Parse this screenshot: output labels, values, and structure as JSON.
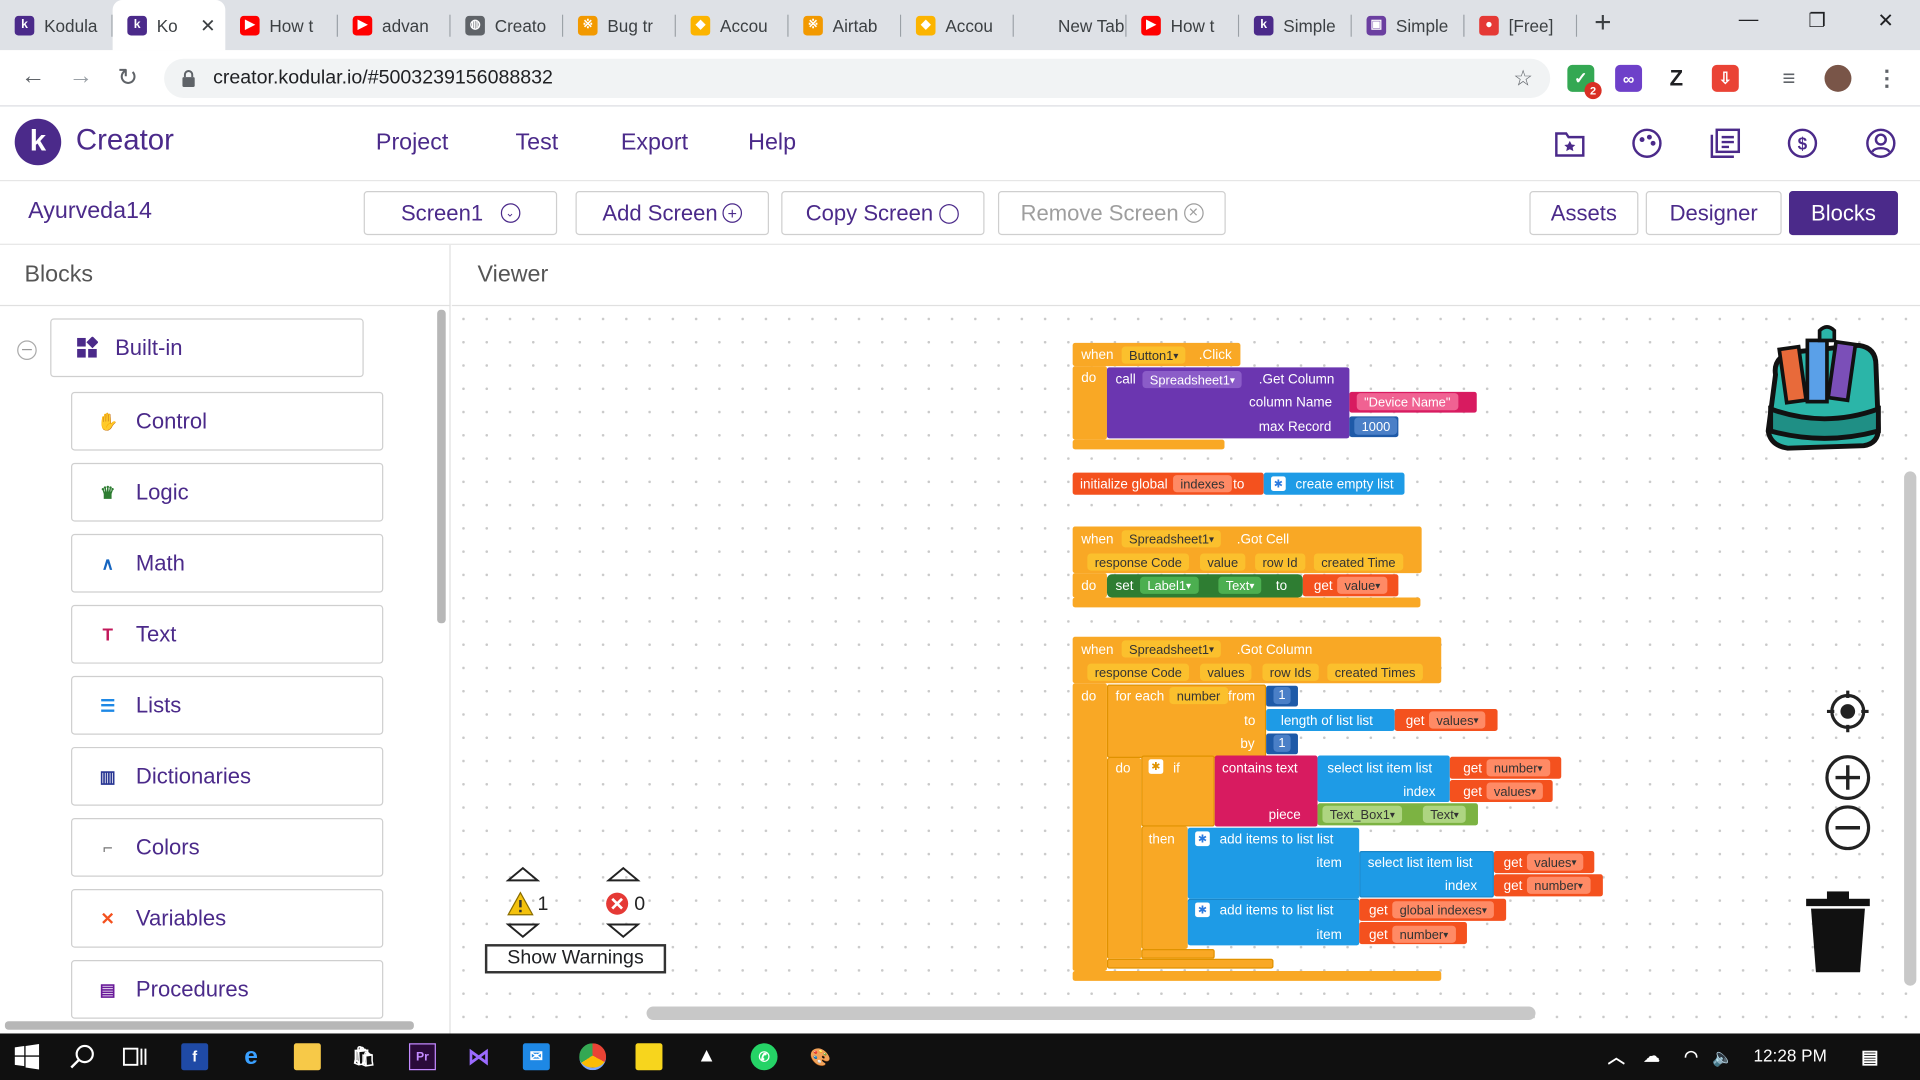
{
  "browser": {
    "tabs": [
      {
        "title": "Kodula",
        "fav": "k",
        "color": "#4b2a8a"
      },
      {
        "title": "Ko",
        "fav": "k",
        "color": "#4b2a8a",
        "active": true
      },
      {
        "title": "How t",
        "fav": "▶",
        "color": "#ff0000"
      },
      {
        "title": "advan",
        "fav": "▶",
        "color": "#ff0000"
      },
      {
        "title": "Creato",
        "fav": "◍",
        "color": "#5f6368"
      },
      {
        "title": "Bug tr",
        "fav": "※",
        "color": "#f29900"
      },
      {
        "title": "Accou",
        "fav": "◆",
        "color": "#fcb400"
      },
      {
        "title": "Airtab",
        "fav": "※",
        "color": "#f29900"
      },
      {
        "title": "Accou",
        "fav": "◆",
        "color": "#fcb400"
      },
      {
        "title": "New Tab",
        "fav": "",
        "color": "transparent"
      },
      {
        "title": "How t",
        "fav": "▶",
        "color": "#ff0000"
      },
      {
        "title": "Simple",
        "fav": "k",
        "color": "#4b2a8a"
      },
      {
        "title": "Simple",
        "fav": "▣",
        "color": "#6b3fa0"
      },
      {
        "title": "[Free]",
        "fav": "●",
        "color": "#e53935"
      }
    ],
    "url": "creator.kodular.io/#5003239156088832",
    "badge_count": "2"
  },
  "app": {
    "brand": "Creator",
    "menu": [
      "Project",
      "Test",
      "Export",
      "Help"
    ],
    "header_icons": [
      "folder-star-icon",
      "palette-icon",
      "library-icon",
      "dollar-icon",
      "account-icon"
    ],
    "project_name": "Ayurveda14",
    "screen_select": "Screen1",
    "add_screen": "Add Screen",
    "copy_screen": "Copy Screen",
    "remove_screen": "Remove Screen",
    "assets": "Assets",
    "designer": "Designer",
    "blocks": "Blocks"
  },
  "blocks_panel": {
    "title": "Blocks",
    "builtin": "Built-in",
    "categories": [
      {
        "label": "Control",
        "icon": "control-icon",
        "color": "#f9a825"
      },
      {
        "label": "Logic",
        "icon": "logic-icon",
        "color": "#2e7d32"
      },
      {
        "label": "Math",
        "icon": "math-icon",
        "color": "#1565c0"
      },
      {
        "label": "Text",
        "icon": "text-icon",
        "color": "#c2185b"
      },
      {
        "label": "Lists",
        "icon": "lists-icon",
        "color": "#1e88e5"
      },
      {
        "label": "Dictionaries",
        "icon": "dictionaries-icon",
        "color": "#283593"
      },
      {
        "label": "Colors",
        "icon": "colors-icon",
        "color": "#757575"
      },
      {
        "label": "Variables",
        "icon": "variables-icon",
        "color": "#f4511e"
      },
      {
        "label": "Procedures",
        "icon": "procedures-icon",
        "color": "#6a1b9a"
      }
    ]
  },
  "viewer": {
    "title": "Viewer",
    "warnings_count": "1",
    "errors_count": "0",
    "show_warnings": "Show Warnings",
    "block1": {
      "when": "when",
      "component": "Button1",
      "event": ".Click",
      "do": "do",
      "call": "call",
      "target": "Spreadsheet1",
      "method": ".Get Column",
      "column_name": "column Name",
      "column_value": "Device Name",
      "max_record": "max Record",
      "max_value": "1000"
    },
    "block2": {
      "init": "initialize global",
      "name": "indexes",
      "to": "to",
      "create": "create empty list"
    },
    "block3": {
      "when": "when",
      "component": "Spreadsheet1",
      "event": ".Got Cell",
      "params": [
        "response Code",
        "value",
        "row Id",
        "created Time"
      ],
      "do": "do",
      "set": "set",
      "label": "Label1",
      "prop": "Text",
      "to": "to",
      "get": "get",
      "get_value": "value"
    },
    "block4": {
      "when": "when",
      "component": "Spreadsheet1",
      "event": ".Got Column",
      "params": [
        "response Code",
        "values",
        "row Ids",
        "created Times"
      ],
      "do": "do",
      "for_each": "for each",
      "var": "number",
      "from": "from",
      "from_val": "1",
      "to": "to",
      "length": "length of list  list",
      "get": "get",
      "values": "values",
      "by": "by",
      "by_val": "1",
      "do2": "do",
      "if": "if",
      "contains": "contains text",
      "select": "select list item  list",
      "index": "index",
      "number": "number",
      "piece": "piece",
      "textbox": "Text_Box1",
      "text_prop": "Text",
      "then": "then",
      "add_items": "add items to list   list",
      "item": "item",
      "global_indexes": "global indexes"
    }
  },
  "taskbar": {
    "time": "12:28 PM"
  }
}
